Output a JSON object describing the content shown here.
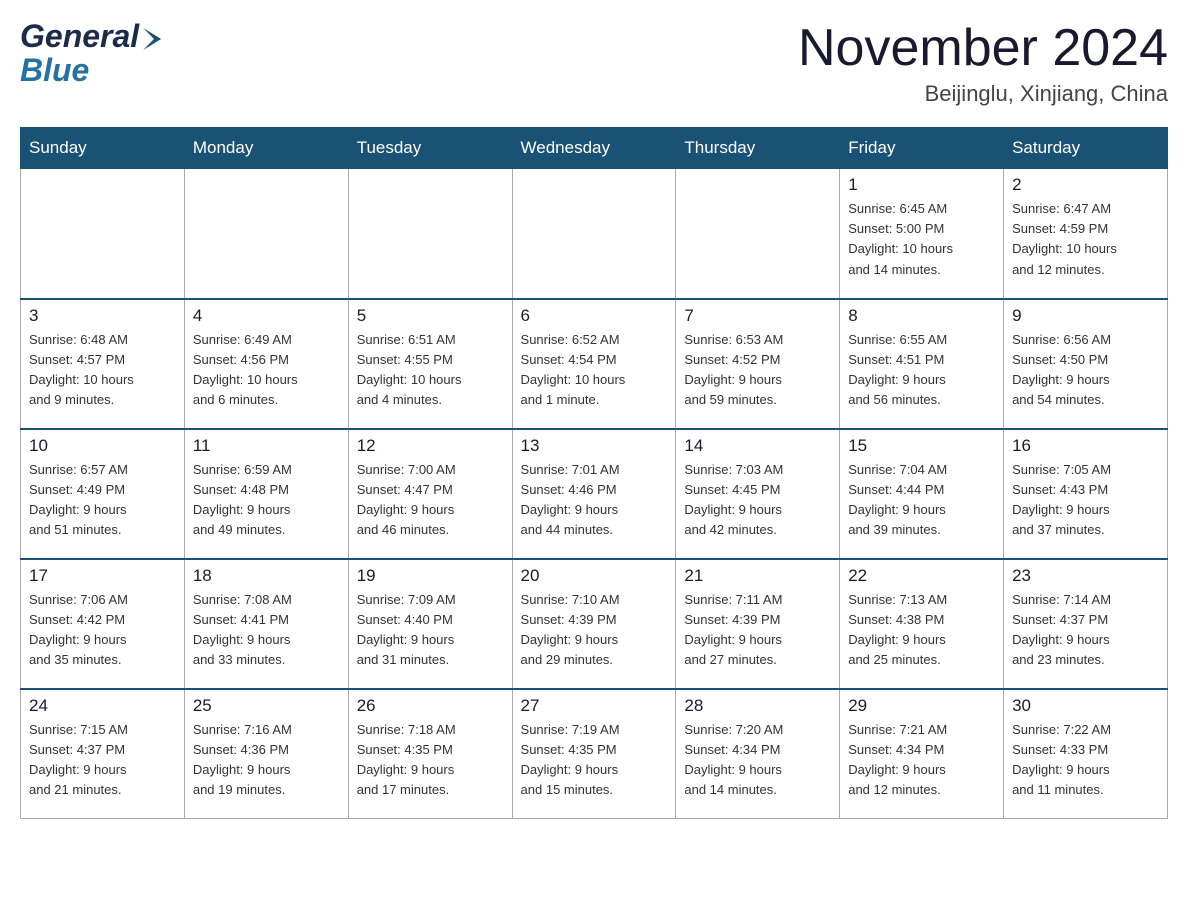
{
  "header": {
    "logo": {
      "general": "General",
      "blue": "Blue"
    },
    "title": "November 2024",
    "location": "Beijinglu, Xinjiang, China"
  },
  "weekdays": [
    "Sunday",
    "Monday",
    "Tuesday",
    "Wednesday",
    "Thursday",
    "Friday",
    "Saturday"
  ],
  "weeks": [
    [
      {
        "day": "",
        "info": ""
      },
      {
        "day": "",
        "info": ""
      },
      {
        "day": "",
        "info": ""
      },
      {
        "day": "",
        "info": ""
      },
      {
        "day": "",
        "info": ""
      },
      {
        "day": "1",
        "info": "Sunrise: 6:45 AM\nSunset: 5:00 PM\nDaylight: 10 hours\nand 14 minutes."
      },
      {
        "day": "2",
        "info": "Sunrise: 6:47 AM\nSunset: 4:59 PM\nDaylight: 10 hours\nand 12 minutes."
      }
    ],
    [
      {
        "day": "3",
        "info": "Sunrise: 6:48 AM\nSunset: 4:57 PM\nDaylight: 10 hours\nand 9 minutes."
      },
      {
        "day": "4",
        "info": "Sunrise: 6:49 AM\nSunset: 4:56 PM\nDaylight: 10 hours\nand 6 minutes."
      },
      {
        "day": "5",
        "info": "Sunrise: 6:51 AM\nSunset: 4:55 PM\nDaylight: 10 hours\nand 4 minutes."
      },
      {
        "day": "6",
        "info": "Sunrise: 6:52 AM\nSunset: 4:54 PM\nDaylight: 10 hours\nand 1 minute."
      },
      {
        "day": "7",
        "info": "Sunrise: 6:53 AM\nSunset: 4:52 PM\nDaylight: 9 hours\nand 59 minutes."
      },
      {
        "day": "8",
        "info": "Sunrise: 6:55 AM\nSunset: 4:51 PM\nDaylight: 9 hours\nand 56 minutes."
      },
      {
        "day": "9",
        "info": "Sunrise: 6:56 AM\nSunset: 4:50 PM\nDaylight: 9 hours\nand 54 minutes."
      }
    ],
    [
      {
        "day": "10",
        "info": "Sunrise: 6:57 AM\nSunset: 4:49 PM\nDaylight: 9 hours\nand 51 minutes."
      },
      {
        "day": "11",
        "info": "Sunrise: 6:59 AM\nSunset: 4:48 PM\nDaylight: 9 hours\nand 49 minutes."
      },
      {
        "day": "12",
        "info": "Sunrise: 7:00 AM\nSunset: 4:47 PM\nDaylight: 9 hours\nand 46 minutes."
      },
      {
        "day": "13",
        "info": "Sunrise: 7:01 AM\nSunset: 4:46 PM\nDaylight: 9 hours\nand 44 minutes."
      },
      {
        "day": "14",
        "info": "Sunrise: 7:03 AM\nSunset: 4:45 PM\nDaylight: 9 hours\nand 42 minutes."
      },
      {
        "day": "15",
        "info": "Sunrise: 7:04 AM\nSunset: 4:44 PM\nDaylight: 9 hours\nand 39 minutes."
      },
      {
        "day": "16",
        "info": "Sunrise: 7:05 AM\nSunset: 4:43 PM\nDaylight: 9 hours\nand 37 minutes."
      }
    ],
    [
      {
        "day": "17",
        "info": "Sunrise: 7:06 AM\nSunset: 4:42 PM\nDaylight: 9 hours\nand 35 minutes."
      },
      {
        "day": "18",
        "info": "Sunrise: 7:08 AM\nSunset: 4:41 PM\nDaylight: 9 hours\nand 33 minutes."
      },
      {
        "day": "19",
        "info": "Sunrise: 7:09 AM\nSunset: 4:40 PM\nDaylight: 9 hours\nand 31 minutes."
      },
      {
        "day": "20",
        "info": "Sunrise: 7:10 AM\nSunset: 4:39 PM\nDaylight: 9 hours\nand 29 minutes."
      },
      {
        "day": "21",
        "info": "Sunrise: 7:11 AM\nSunset: 4:39 PM\nDaylight: 9 hours\nand 27 minutes."
      },
      {
        "day": "22",
        "info": "Sunrise: 7:13 AM\nSunset: 4:38 PM\nDaylight: 9 hours\nand 25 minutes."
      },
      {
        "day": "23",
        "info": "Sunrise: 7:14 AM\nSunset: 4:37 PM\nDaylight: 9 hours\nand 23 minutes."
      }
    ],
    [
      {
        "day": "24",
        "info": "Sunrise: 7:15 AM\nSunset: 4:37 PM\nDaylight: 9 hours\nand 21 minutes."
      },
      {
        "day": "25",
        "info": "Sunrise: 7:16 AM\nSunset: 4:36 PM\nDaylight: 9 hours\nand 19 minutes."
      },
      {
        "day": "26",
        "info": "Sunrise: 7:18 AM\nSunset: 4:35 PM\nDaylight: 9 hours\nand 17 minutes."
      },
      {
        "day": "27",
        "info": "Sunrise: 7:19 AM\nSunset: 4:35 PM\nDaylight: 9 hours\nand 15 minutes."
      },
      {
        "day": "28",
        "info": "Sunrise: 7:20 AM\nSunset: 4:34 PM\nDaylight: 9 hours\nand 14 minutes."
      },
      {
        "day": "29",
        "info": "Sunrise: 7:21 AM\nSunset: 4:34 PM\nDaylight: 9 hours\nand 12 minutes."
      },
      {
        "day": "30",
        "info": "Sunrise: 7:22 AM\nSunset: 4:33 PM\nDaylight: 9 hours\nand 11 minutes."
      }
    ]
  ]
}
